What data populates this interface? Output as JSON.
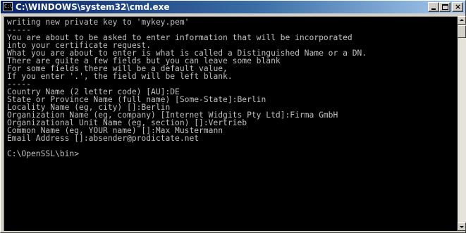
{
  "window": {
    "title": "C:\\WINDOWS\\system32\\cmd.exe",
    "icon_label": "C:\\",
    "icon": "console-icon",
    "controls": {
      "minimize_icon": "minimize-icon",
      "maximize_icon": "maximize-icon",
      "close_icon": "close-icon",
      "close_glyph": "×"
    }
  },
  "console": {
    "lines": [
      "writing new private key to 'mykey.pem'",
      "-----",
      "You are about to be asked to enter information that will be incorporated",
      "into your certificate request.",
      "What you are about to enter is what is called a Distinguished Name or a DN.",
      "There are quite a few fields but you can leave some blank",
      "For some fields there will be a default value,",
      "If you enter '.', the field will be left blank.",
      "-----",
      "Country Name (2 letter code) [AU]:DE",
      "State or Province Name (full name) [Some-State]:Berlin",
      "Locality Name (eg, city) []:Berlin",
      "Organization Name (eg, company) [Internet Widgits Pty Ltd]:Firma GmbH",
      "Organizational Unit Name (eg, section) []:Vertrieb",
      "Common Name (eg, YOUR name) []:Max Mustermann",
      "Email Address []:absender@prodictate.net",
      "",
      "C:\\OpenSSL\\bin>"
    ]
  },
  "scrollbar": {
    "up_icon": "scroll-up-arrow-icon",
    "down_icon": "scroll-down-arrow-icon"
  },
  "colors": {
    "console_bg": "#000000",
    "console_text": "#c0c0c0",
    "titlebar_start": "#0a246a",
    "titlebar_end": "#a6caf0",
    "chrome": "#d4d0c8"
  }
}
